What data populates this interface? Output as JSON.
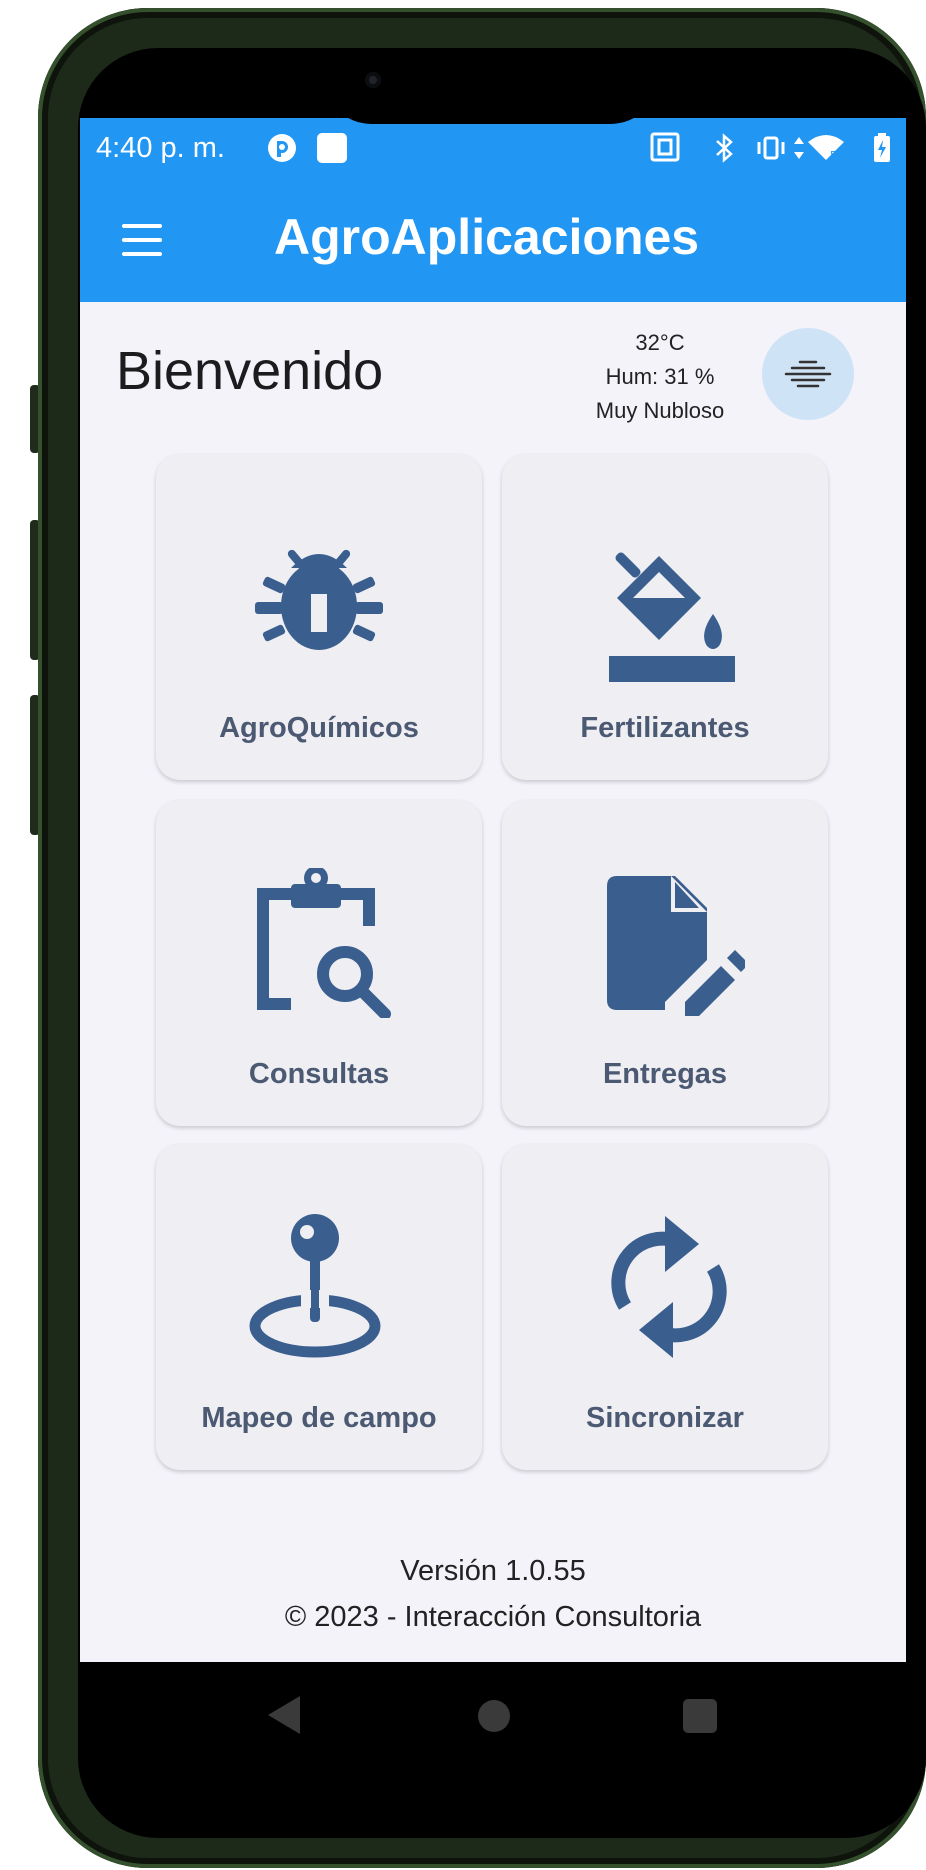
{
  "status_bar": {
    "time": "4:40 p. m."
  },
  "app_bar": {
    "title": "AgroAplicaciones"
  },
  "header": {
    "welcome": "Bienvenido"
  },
  "weather": {
    "temperature": "32°C",
    "humidity": "Hum: 31 %",
    "condition": "Muy Nubloso"
  },
  "menu": [
    {
      "label": "AgroQuímicos",
      "icon": "bug-icon"
    },
    {
      "label": "Fertilizantes",
      "icon": "format-color-fill-icon"
    },
    {
      "label": "Consultas",
      "icon": "clipboard-search-icon"
    },
    {
      "label": "Entregas",
      "icon": "document-edit-icon"
    },
    {
      "label": "Mapeo de campo",
      "icon": "map-pin-icon"
    },
    {
      "label": "Sincronizar",
      "icon": "sync-icon"
    }
  ],
  "footer": {
    "version": "Versión 1.0.55",
    "copyright": "© 2023 - Interacción Consultoria"
  },
  "colors": {
    "app_bar": "#2196f3",
    "background": "#f4f3fa",
    "tile": "#efeef3",
    "icon": "#3a5f8f",
    "label": "#4b5a72"
  }
}
